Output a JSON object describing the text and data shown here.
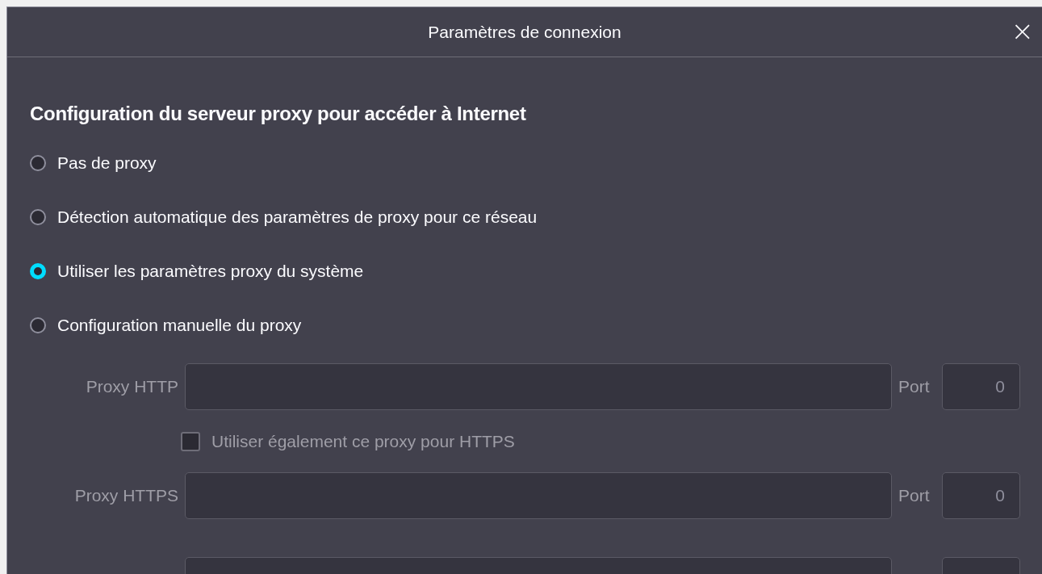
{
  "window": {
    "title": "Paramètres de connexion",
    "close": "×"
  },
  "section": {
    "heading": "Configuration du serveur proxy pour accéder à Internet"
  },
  "options": [
    {
      "label": "Pas de proxy",
      "selected": false
    },
    {
      "label": "Détection automatique des paramètres de proxy pour ce réseau",
      "selected": false
    },
    {
      "label": "Utiliser les paramètres proxy du système",
      "selected": true
    },
    {
      "label": "Configuration manuelle du proxy",
      "selected": false
    }
  ],
  "manual": {
    "disabled": true,
    "rows": [
      {
        "kind": "proxy",
        "label": "Proxy HTTP",
        "port_label": "Port",
        "port": "0"
      },
      {
        "kind": "checkbox",
        "label": "Utiliser également ce proxy pour HTTPS",
        "checked": false
      },
      {
        "kind": "proxy",
        "label": "Proxy HTTPS",
        "port_label": "Port",
        "port": "0"
      },
      {
        "kind": "cut"
      }
    ]
  }
}
